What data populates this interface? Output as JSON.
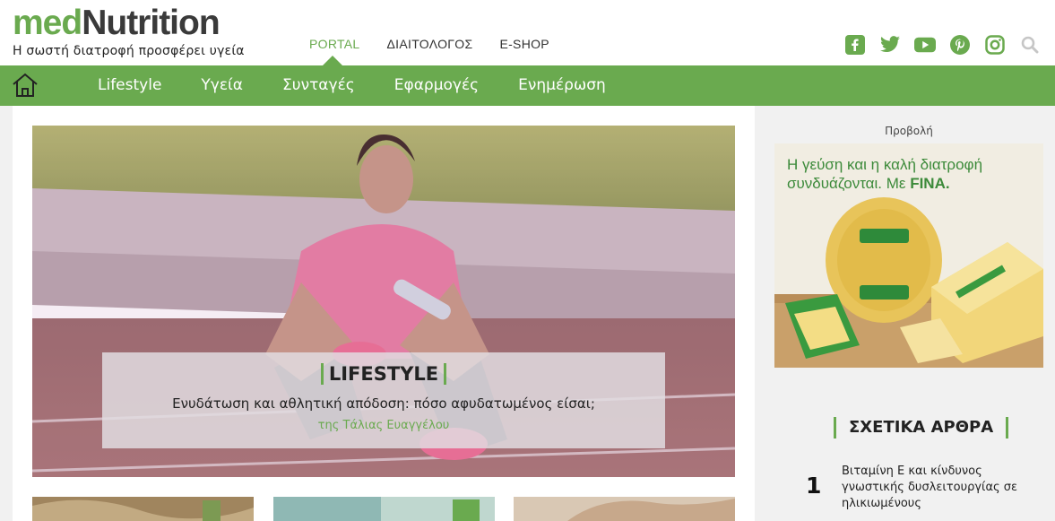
{
  "brand": {
    "part1": "med",
    "part2": "Nutrition",
    "tagline": "Η σωστή διατροφή προσφέρει υγεία"
  },
  "topnav": [
    {
      "label": "PORTAL"
    },
    {
      "label": "ΔΙΑΙΤΟΛΟΓΟΣ"
    },
    {
      "label": "E-SHOP"
    }
  ],
  "social": [
    "facebook-icon",
    "twitter-icon",
    "youtube-icon",
    "pinterest-icon",
    "instagram-icon",
    "search-icon"
  ],
  "mainnav": [
    {
      "label": "Lifestyle"
    },
    {
      "label": "Υγεία"
    },
    {
      "label": "Συνταγές"
    },
    {
      "label": "Εφαρμογές"
    },
    {
      "label": "Ενημέρωση"
    }
  ],
  "hero": {
    "category": "LIFESTYLE",
    "title": "Ενυδάτωση και αθλητική απόδοση: πόσο αφυδατωμένος είσαι;",
    "byline": "της Τάλιας Ευαγγέλου"
  },
  "sidebar": {
    "ad_label": "Προβολή",
    "ad_text_line1": "Η γεύση και η καλή διατροφή",
    "ad_text_line2": "συνδυάζονται. Με ",
    "ad_brand": "FINA.",
    "related_title": "ΣΧΕΤΙΚΑ ΑΡΘΡΑ",
    "related": [
      {
        "num": "1",
        "title": "Βιταμίνη Ε και κίνδυνος γνωστικής δυσλειτουργίας σε ηλικιωμένους"
      }
    ]
  },
  "colors": {
    "brand_green": "#6aaa4f",
    "text_dark": "#3a3a3a"
  }
}
